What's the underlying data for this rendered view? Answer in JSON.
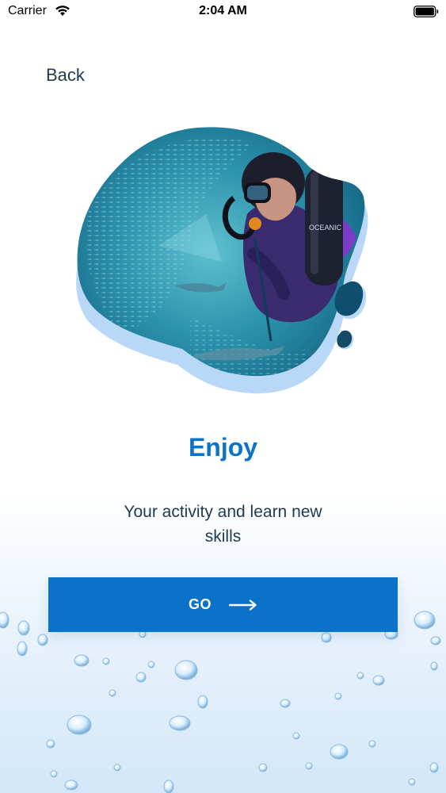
{
  "status_bar": {
    "carrier": "Carrier",
    "time": "2:04 AM"
  },
  "nav": {
    "back_label": "Back"
  },
  "hero": {
    "image": "scuba-diver-with-fish-school"
  },
  "content": {
    "title": "Enjoy",
    "subtitle": "Your activity and learn new skills"
  },
  "action": {
    "go_label": "GO",
    "arrow_icon": "arrow-right-icon"
  },
  "colors": {
    "accent": "#0b74c8",
    "text": "#1f3a4d",
    "button": "#0b72c9"
  }
}
